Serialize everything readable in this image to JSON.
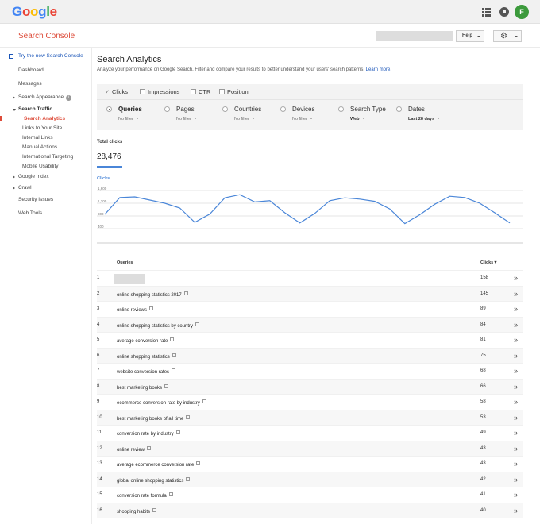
{
  "header": {
    "logo_letters": [
      {
        "ch": "G",
        "color": "#4285F4"
      },
      {
        "ch": "o",
        "color": "#EA4335"
      },
      {
        "ch": "o",
        "color": "#FBBC05"
      },
      {
        "ch": "g",
        "color": "#4285F4"
      },
      {
        "ch": "l",
        "color": "#34A853"
      },
      {
        "ch": "e",
        "color": "#EA4335"
      }
    ],
    "avatar_letter": "F"
  },
  "subbar": {
    "product_name": "Search Console",
    "help_label": "Help",
    "settings_icon": "gear-icon"
  },
  "sidebar": {
    "items": [
      {
        "name": "try-new-search-console",
        "label": "Try the new Search Console",
        "style": "new",
        "level": 0
      },
      {
        "name": "dashboard",
        "label": "Dashboard",
        "level": 0
      },
      {
        "name": "messages",
        "label": "Messages",
        "level": 0
      },
      {
        "name": "search-appearance",
        "label": "Search Appearance",
        "level": 0,
        "caret": "right",
        "info": true
      },
      {
        "name": "search-traffic",
        "label": "Search Traffic",
        "level": 0,
        "caret": "down",
        "style": "bold"
      },
      {
        "name": "search-analytics",
        "label": "Search Analytics",
        "level": 1,
        "style": "active"
      },
      {
        "name": "links-to-your-site",
        "label": "Links to Your Site",
        "level": 1
      },
      {
        "name": "internal-links",
        "label": "Internal Links",
        "level": 1
      },
      {
        "name": "manual-actions",
        "label": "Manual Actions",
        "level": 1
      },
      {
        "name": "international-targeting",
        "label": "International Targeting",
        "level": 1
      },
      {
        "name": "mobile-usability",
        "label": "Mobile Usability",
        "level": 1
      },
      {
        "name": "google-index",
        "label": "Google Index",
        "level": 0,
        "caret": "right"
      },
      {
        "name": "crawl",
        "label": "Crawl",
        "level": 0,
        "caret": "right"
      },
      {
        "name": "security-issues",
        "label": "Security Issues",
        "level": 0
      },
      {
        "name": "web-tools",
        "label": "Web Tools",
        "level": 0
      }
    ]
  },
  "main": {
    "title": "Search Analytics",
    "description": "Analyze your performance on Google Search. Filter and compare your results to better understand your users' search patterns.",
    "learn_more": "Learn more.",
    "metrics": [
      {
        "name": "clicks",
        "label": "Clicks",
        "checked": true
      },
      {
        "name": "impressions",
        "label": "Impressions",
        "checked": false
      },
      {
        "name": "ctr",
        "label": "CTR",
        "checked": false
      },
      {
        "name": "position",
        "label": "Position",
        "checked": false
      }
    ],
    "groups": [
      {
        "name": "queries",
        "label": "Queries",
        "filter": "No filter",
        "selected": true
      },
      {
        "name": "pages",
        "label": "Pages",
        "filter": "No filter",
        "selected": false
      },
      {
        "name": "countries",
        "label": "Countries",
        "filter": "No filter",
        "selected": false
      },
      {
        "name": "devices",
        "label": "Devices",
        "filter": "No filter",
        "selected": false
      },
      {
        "name": "search-type",
        "label": "Search Type",
        "filter": "Web",
        "selected": false,
        "filter_bold": true
      },
      {
        "name": "dates",
        "label": "Dates",
        "filter": "Last 28 days",
        "selected": false,
        "filter_bold": true
      }
    ],
    "total": {
      "label": "Total clicks",
      "value": "28,476",
      "accent": "#4a86d8"
    },
    "chart": {
      "title": "Clicks",
      "y_ticks": [
        "1,600",
        "1,200",
        "800",
        "400"
      ],
      "y_tick_values": [
        1600,
        1200,
        800,
        400
      ],
      "ylim": [
        0,
        1800
      ],
      "line_color": "#4a86d8",
      "values": [
        850,
        1380,
        1400,
        1300,
        1200,
        1050,
        600,
        860,
        1370,
        1470,
        1240,
        1280,
        900,
        580,
        880,
        1280,
        1370,
        1330,
        1260,
        1020,
        560,
        840,
        1170,
        1420,
        1380,
        1200,
        900,
        580
      ]
    },
    "table": {
      "col_query": "Queries",
      "col_clicks": "Clicks▼",
      "row_icon": "open-in-new-icon",
      "chevron": "»",
      "rows": [
        {
          "num": "1",
          "query": "",
          "hidden": true,
          "clicks": "158"
        },
        {
          "num": "2",
          "query": "online shopping statistics 2017",
          "clicks": "145"
        },
        {
          "num": "3",
          "query": "online reviews",
          "clicks": "89"
        },
        {
          "num": "4",
          "query": "online shopping statistics by country",
          "clicks": "84"
        },
        {
          "num": "5",
          "query": "average conversion rate",
          "clicks": "81"
        },
        {
          "num": "6",
          "query": "online shopping statistics",
          "clicks": "75"
        },
        {
          "num": "7",
          "query": "website conversion rates",
          "clicks": "68"
        },
        {
          "num": "8",
          "query": "best marketing books",
          "clicks": "66"
        },
        {
          "num": "9",
          "query": "ecommerce conversion rate by industry",
          "clicks": "58"
        },
        {
          "num": "10",
          "query": "best marketing books of all time",
          "clicks": "53"
        },
        {
          "num": "11",
          "query": "conversion rate by industry",
          "clicks": "49"
        },
        {
          "num": "12",
          "query": "online review",
          "clicks": "43"
        },
        {
          "num": "13",
          "query": "average ecommerce conversion rate",
          "clicks": "43"
        },
        {
          "num": "14",
          "query": "global online shopping statistics",
          "clicks": "42"
        },
        {
          "num": "15",
          "query": "conversion rate formula",
          "clicks": "41"
        },
        {
          "num": "16",
          "query": "shopping habits",
          "clicks": "40"
        }
      ]
    }
  }
}
